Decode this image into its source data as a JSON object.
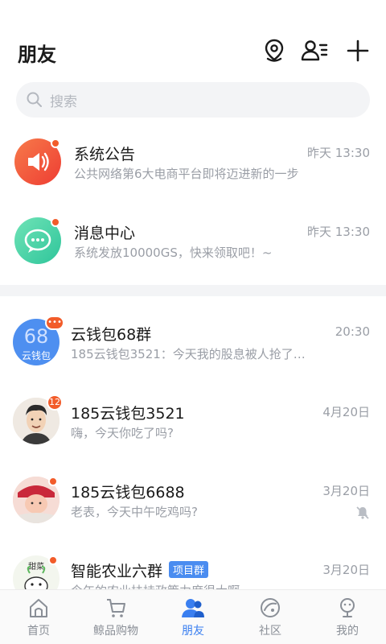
{
  "header": {
    "title": "朋友"
  },
  "search": {
    "placeholder": "搜索"
  },
  "system_rows": [
    {
      "name": "系统公告",
      "message": "公共网络第6大电商平台即将迈进新的一步",
      "time": "昨天 13:30"
    },
    {
      "name": "消息中心",
      "message": "系统发放10000GS，快来领取吧！~",
      "time": "昨天 13:30"
    }
  ],
  "chats": [
    {
      "name": "云钱包68群",
      "message": "185云钱包3521：今天我的股息被人抢了…",
      "time": "20:30",
      "avatar_big": "68",
      "avatar_small": "云钱包",
      "badge": "•••"
    },
    {
      "name": "185云钱包3521",
      "message": "嗨，今天你吃了吗?",
      "time": "4月20日",
      "badge": "12"
    },
    {
      "name": "185云钱包6688",
      "message": "老表，今天中午吃鸡吗?",
      "time": "3月20日",
      "muted": true
    },
    {
      "name": "智能农业六群",
      "tag": "项目群",
      "message": "今年的农业扶持政策力度很大啊",
      "time": "3月20日",
      "avatar_text": "甜菜"
    }
  ],
  "tabs": [
    {
      "label": "首页",
      "icon": "home-icon"
    },
    {
      "label": "鲸品购物",
      "icon": "cart-icon"
    },
    {
      "label": "朋友",
      "icon": "friends-icon",
      "active": true
    },
    {
      "label": "社区",
      "icon": "community-icon"
    },
    {
      "label": "我的",
      "icon": "profile-icon"
    }
  ],
  "colors": {
    "accent": "#3a7ff0",
    "badge": "#f25c2a",
    "announce": "#f2553a",
    "message_center": "#3fd0a0"
  }
}
